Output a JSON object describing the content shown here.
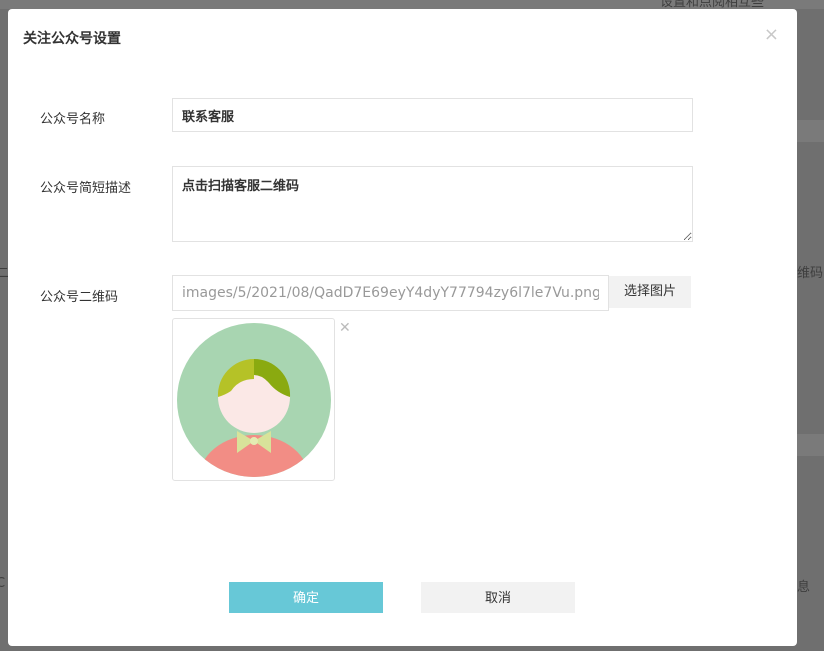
{
  "background": {
    "snippets": [
      "设置和点阅相互些",
      "二",
      "维码",
      "息",
      "C"
    ]
  },
  "dialog": {
    "title": "关注公众号设置",
    "close_glyph": "×",
    "fields": {
      "name_label": "公众号名称",
      "name_value": "联系客服",
      "desc_label": "公众号简短描述",
      "desc_value": "点击扫描客服二维码",
      "qr_label": "公众号二维码",
      "qr_path": "images/5/2021/08/QadD7E69eyY4dyY77794zy6l7le7Vu.png",
      "pick_button": "选择图片",
      "remove_glyph": "✕"
    },
    "buttons": {
      "confirm": "确定",
      "cancel": "取消"
    }
  },
  "colors": {
    "primary": "#67c8d7",
    "overlay": "#6f6f6f"
  }
}
